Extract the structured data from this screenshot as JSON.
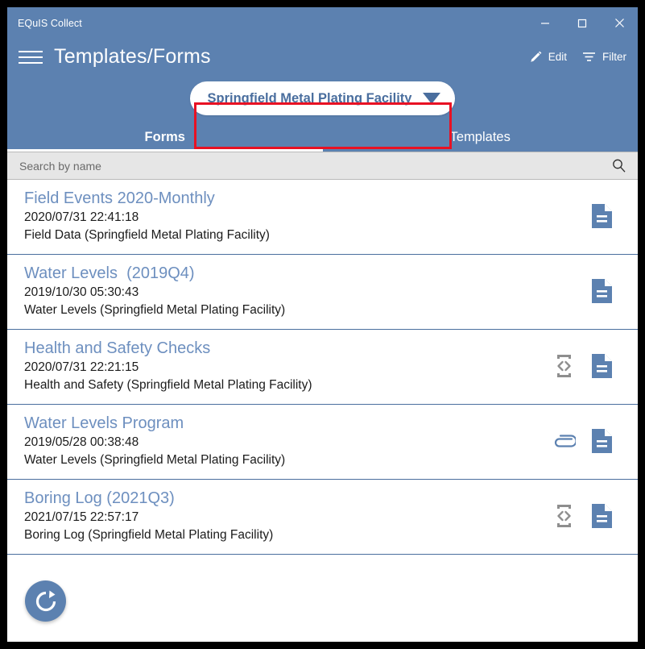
{
  "window": {
    "title": "EQuIS Collect",
    "controls": {
      "minimize": "minimize-button",
      "maximize": "maximize-button",
      "close": "close-button"
    }
  },
  "header": {
    "menu_icon": "hamburger-menu-icon",
    "page_title": "Templates/Forms",
    "actions": [
      {
        "label": "Edit",
        "icon": "pencil-icon"
      },
      {
        "label": "Filter",
        "icon": "filter-icon"
      }
    ]
  },
  "facility_selector": {
    "value": "Springfield Metal Plating Facility",
    "caret_icon": "chevron-down-icon",
    "highlighted": true,
    "highlight_color": "#e81123"
  },
  "tabs": [
    {
      "label": "Forms",
      "active": true
    },
    {
      "label": "Templates",
      "active": false
    }
  ],
  "search": {
    "placeholder": "Search by name",
    "value": "",
    "icon": "search-icon"
  },
  "list": {
    "items": [
      {
        "title": "Field Events 2020-Monthly",
        "date": "2020/07/31 22:41:18",
        "subtitle": "Field Data (Springfield Metal Plating Facility)",
        "icons": [
          "form-document-icon"
        ]
      },
      {
        "title": "Water Levels  (2019Q4)",
        "date": "2019/10/30 05:30:43",
        "subtitle": "Water Levels (Springfield Metal Plating Facility)",
        "icons": [
          "form-document-icon"
        ]
      },
      {
        "title": "Health and Safety Checks",
        "date": "2020/07/31 22:21:15",
        "subtitle": "Health and Safety (Springfield Metal Plating Facility)",
        "icons": [
          "code-script-icon",
          "form-document-icon"
        ]
      },
      {
        "title": "Water Levels Program",
        "date": "2019/05/28 00:38:48",
        "subtitle": "Water Levels (Springfield Metal Plating Facility)",
        "icons": [
          "paperclip-attachment-icon",
          "form-document-icon"
        ]
      },
      {
        "title": "Boring Log (2021Q3)",
        "date": "2021/07/15 22:57:17",
        "subtitle": "Boring Log (Springfield Metal Plating Facility)",
        "icons": [
          "code-script-icon",
          "form-document-icon"
        ]
      }
    ]
  },
  "footer": {
    "refresh_icon": "refresh-sync-icon"
  },
  "colors": {
    "header_blue": "#5c81b0",
    "title_link_blue": "#6d8fbf",
    "pill_text_blue": "#4a6e9e",
    "divider_blue": "#4a6e9e",
    "highlight_red": "#e81123",
    "search_bg": "#e6e6e6"
  }
}
